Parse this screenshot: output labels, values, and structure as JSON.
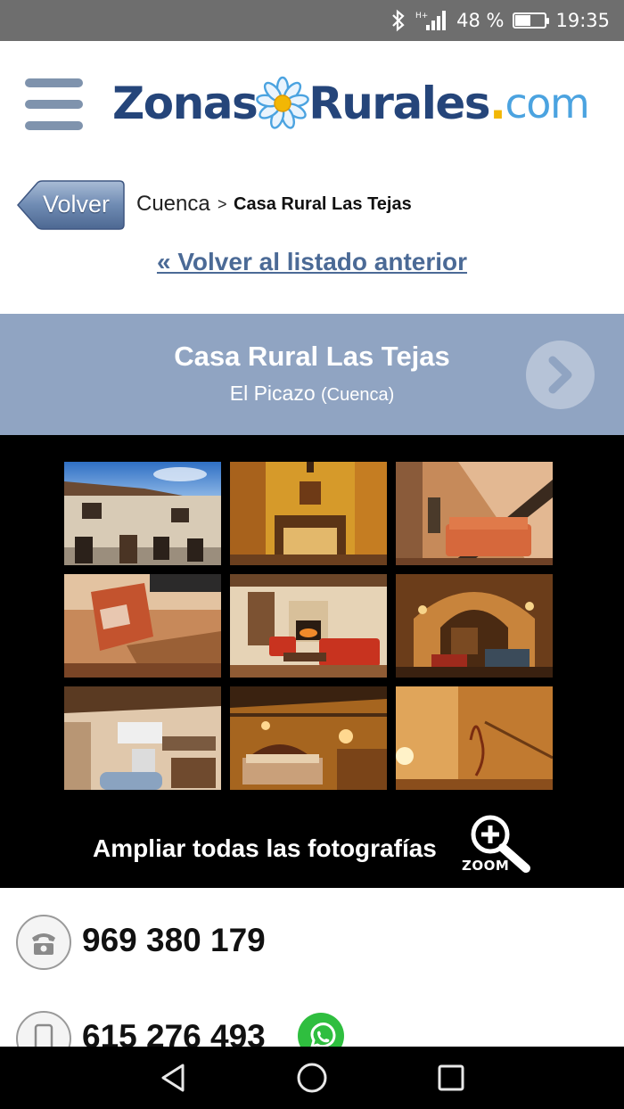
{
  "status_bar": {
    "signal_label": "H+",
    "battery": "48 %",
    "battery_level": 0.48,
    "time": "19:35",
    "icons": [
      "bluetooth-icon",
      "signal-icon",
      "battery-icon"
    ]
  },
  "header": {
    "menu_icon": "hamburger-menu-icon",
    "logo": {
      "part1": "Zonas",
      "part2": "Rurales",
      "dot": ".",
      "tld": "com"
    },
    "colors": {
      "brand_navy": "#25457a",
      "brand_light_blue": "#4ba3e0",
      "accent_yellow": "#f2b705"
    }
  },
  "breadcrumb": {
    "back_button": "Volver",
    "city": "Cuenca",
    "separator": ">",
    "current": "Casa Rural Las Tejas"
  },
  "back_to_list": "« Volver al listado anterior",
  "listing": {
    "name": "Casa Rural Las Tejas",
    "town": "El Picazo",
    "province": "(Cuenca)",
    "next_icon": "chevron-right-icon",
    "band_color": "#90a4c2"
  },
  "gallery": {
    "photos": [
      "exterior-facade-photo",
      "yellow-hallway-photo",
      "staircase-living-room-photo",
      "red-armchair-photo",
      "fireplace-living-room-photo",
      "stone-cellar-photo",
      "kitchen-photo",
      "bedroom-photo",
      "warm-corridor-photo"
    ],
    "zoom_text": "Ampliar todas las fotografías",
    "zoom_label": "ZOOM"
  },
  "contact": {
    "landline": "969 380 179",
    "mobile": "615 276 493",
    "landline_icon": "telephone-icon",
    "mobile_icon": "mobile-phone-icon",
    "whatsapp_icon": "whatsapp-icon"
  },
  "nav_bar": {
    "buttons": [
      "back-triangle-icon",
      "home-circle-icon",
      "recents-square-icon"
    ]
  }
}
